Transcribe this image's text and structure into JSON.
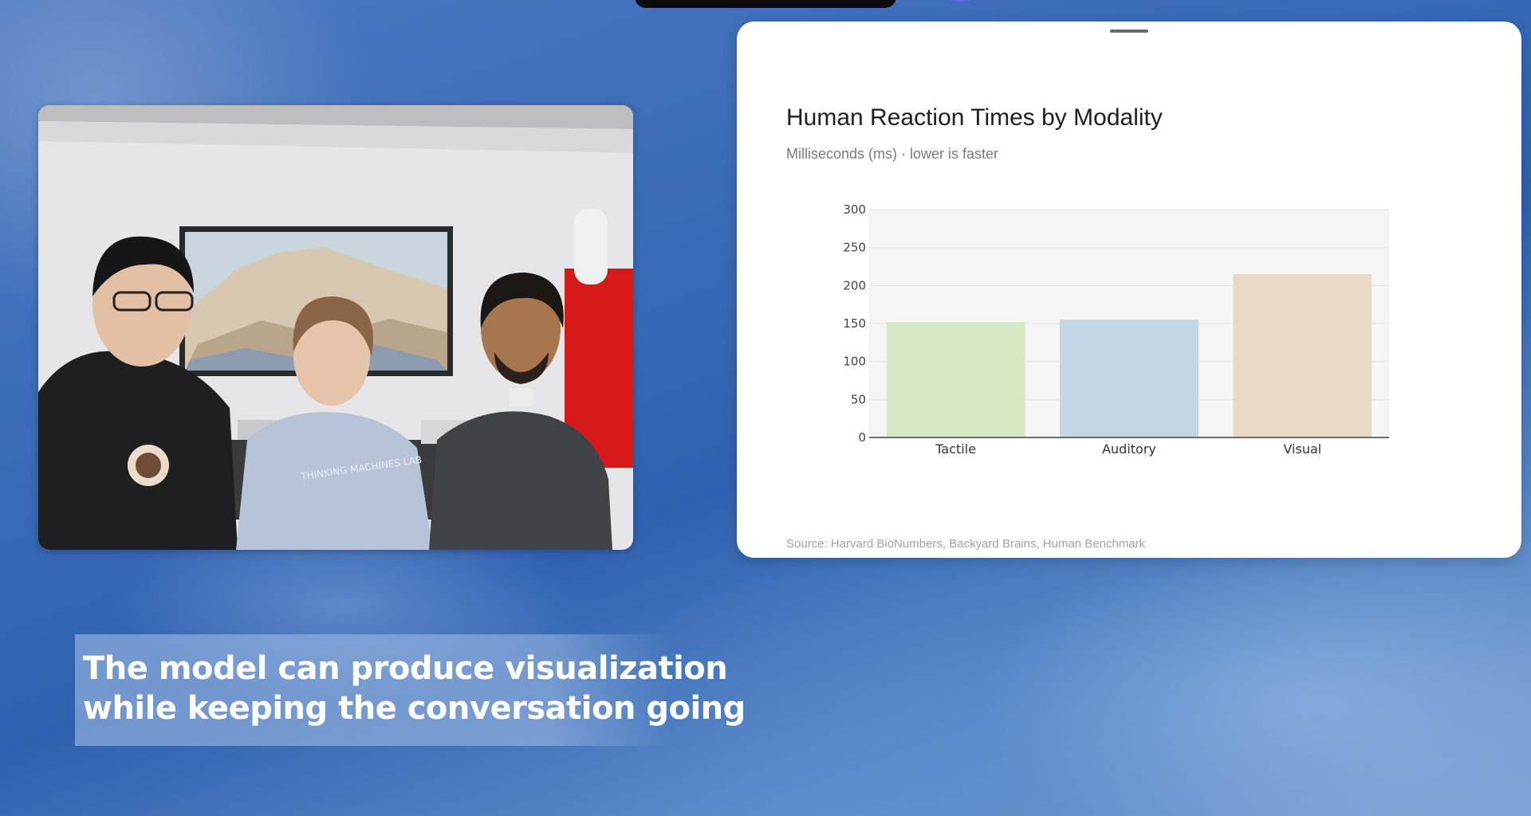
{
  "caption": {
    "line1": "The model can produce visualization",
    "line2": "while keeping the conversation going"
  },
  "video_tile": {
    "shirt_text": "THINKING MACHINES LAB"
  },
  "chart_panel": {
    "title": "Human Reaction Times by Modality",
    "subtitle": "Milliseconds (ms) · lower is faster",
    "source": "Source: Harvard BioNumbers, Backyard Brains, Human Benchmark"
  },
  "chart_data": {
    "type": "bar",
    "title": "Human Reaction Times by Modality",
    "subtitle": "Milliseconds (ms) · lower is faster",
    "categories": [
      "Tactile",
      "Auditory",
      "Visual"
    ],
    "values": [
      152,
      155,
      215
    ],
    "colors": [
      "#d6e7c6",
      "#c4d7e6",
      "#e8d9c5"
    ],
    "ylim": [
      0,
      300
    ],
    "yticks": [
      0,
      50,
      100,
      150,
      200,
      250,
      300
    ],
    "grid": true,
    "plot_background": "#f5f5f5",
    "xlabel": "",
    "ylabel": ""
  },
  "colors": {
    "background": "#3a6bb7",
    "card": "#ffffff",
    "caption_text": "#ffffff"
  }
}
